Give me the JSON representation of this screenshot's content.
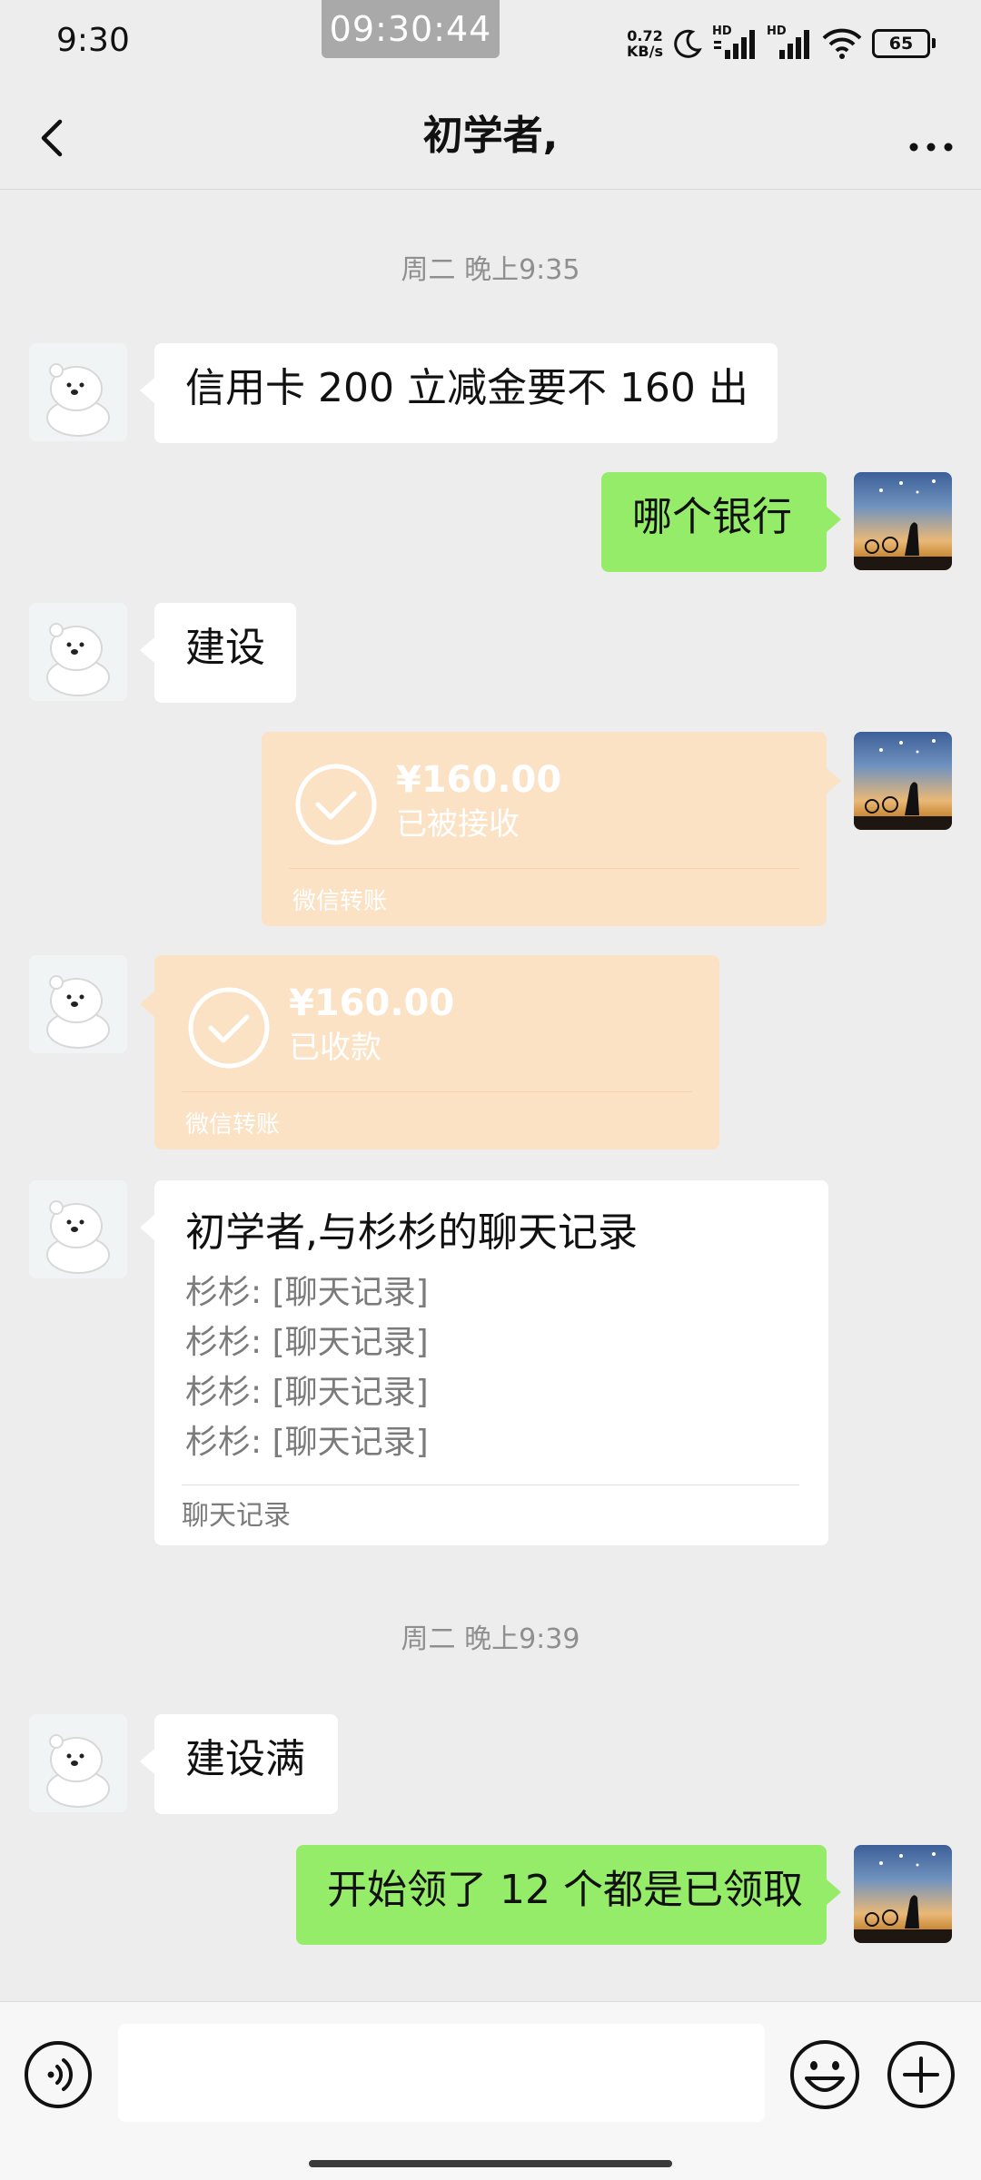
{
  "status_bar": {
    "time": "9:30",
    "clock_overlay": "09:30:44",
    "net_speed_value": "0.72",
    "net_speed_unit": "KB/s",
    "signal_label_1": "HD",
    "signal_label_2": "HD",
    "battery": "65",
    "icons": [
      "moon-icon",
      "signal-icon",
      "signal-icon",
      "wifi-icon",
      "battery-icon"
    ]
  },
  "header": {
    "title": "初学者,",
    "back_icon": "chevron-left-icon",
    "more_icon": "more-dots-icon"
  },
  "messages": {
    "ts1": "周二 晚上9:35",
    "m1": "信用卡 200 立减金要不  160 出",
    "m2": "哪个银行",
    "m3": "建设",
    "t1": {
      "amount": "¥160.00",
      "status": "已被接收",
      "label": "微信转账"
    },
    "t2": {
      "amount": "¥160.00",
      "status": "已收款",
      "label": "微信转账"
    },
    "record": {
      "title": "初学者,与杉杉的聊天记录",
      "lines": [
        "杉杉: [聊天记录]",
        "杉杉: [聊天记录]",
        "杉杉: [聊天记录]",
        "杉杉: [聊天记录]"
      ],
      "footer": "聊天记录"
    },
    "ts2": "周二 晚上9:39",
    "m4": "建设满",
    "m5": "开始领了 12 个都是已领取"
  },
  "input_bar": {
    "placeholder": "",
    "icons": [
      "voice-icon",
      "emoji-icon",
      "plus-icon"
    ]
  },
  "colors": {
    "background": "#ededed",
    "outgoing_bubble": "#95ec69",
    "incoming_bubble": "#ffffff",
    "transfer_bubble": "#fbe2c4"
  }
}
